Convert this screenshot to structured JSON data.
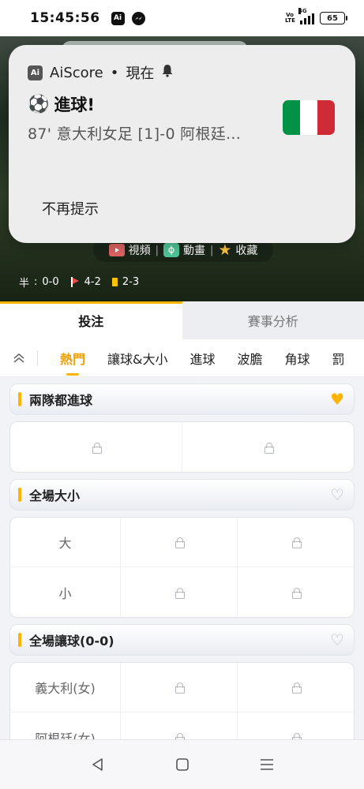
{
  "status_bar": {
    "time": "15:45:56",
    "app_icon_text": "Ai",
    "network_label": "4G",
    "volte_label": "Vo LTE",
    "battery": "65"
  },
  "hero": {
    "actions": [
      {
        "label": "視頻",
        "icon": "video-icon"
      },
      {
        "label": "動畫",
        "icon": "animation-icon"
      },
      {
        "label": "收藏",
        "icon": "star-icon"
      }
    ],
    "half_label": "半",
    "half_score": "0-0",
    "corners": "4-2",
    "cards": "2-3"
  },
  "notification": {
    "app_icon_text": "Ai",
    "app_name": "AiScore",
    "time_label": "現在",
    "title": "進球!",
    "text": "87' 意大利女足 [1]-0 阿根廷...",
    "action": "不再提示",
    "flag_colors": [
      "#009246",
      "#ffffff",
      "#ce2b37"
    ]
  },
  "tabs": {
    "main": [
      "投注",
      "賽事分析"
    ],
    "sub": [
      "熱門",
      "讓球&大小",
      "進球",
      "波膽",
      "角球",
      "罰"
    ]
  },
  "markets": {
    "both_score": {
      "title": "兩隊都進球"
    },
    "total": {
      "title": "全場大小",
      "rows": [
        "大",
        "小"
      ]
    },
    "handicap": {
      "title": "全場讓球(0-0)",
      "rows": [
        "義大利(女)",
        "阿根廷(女)"
      ]
    }
  },
  "colors": {
    "accent": "#ffb400"
  }
}
